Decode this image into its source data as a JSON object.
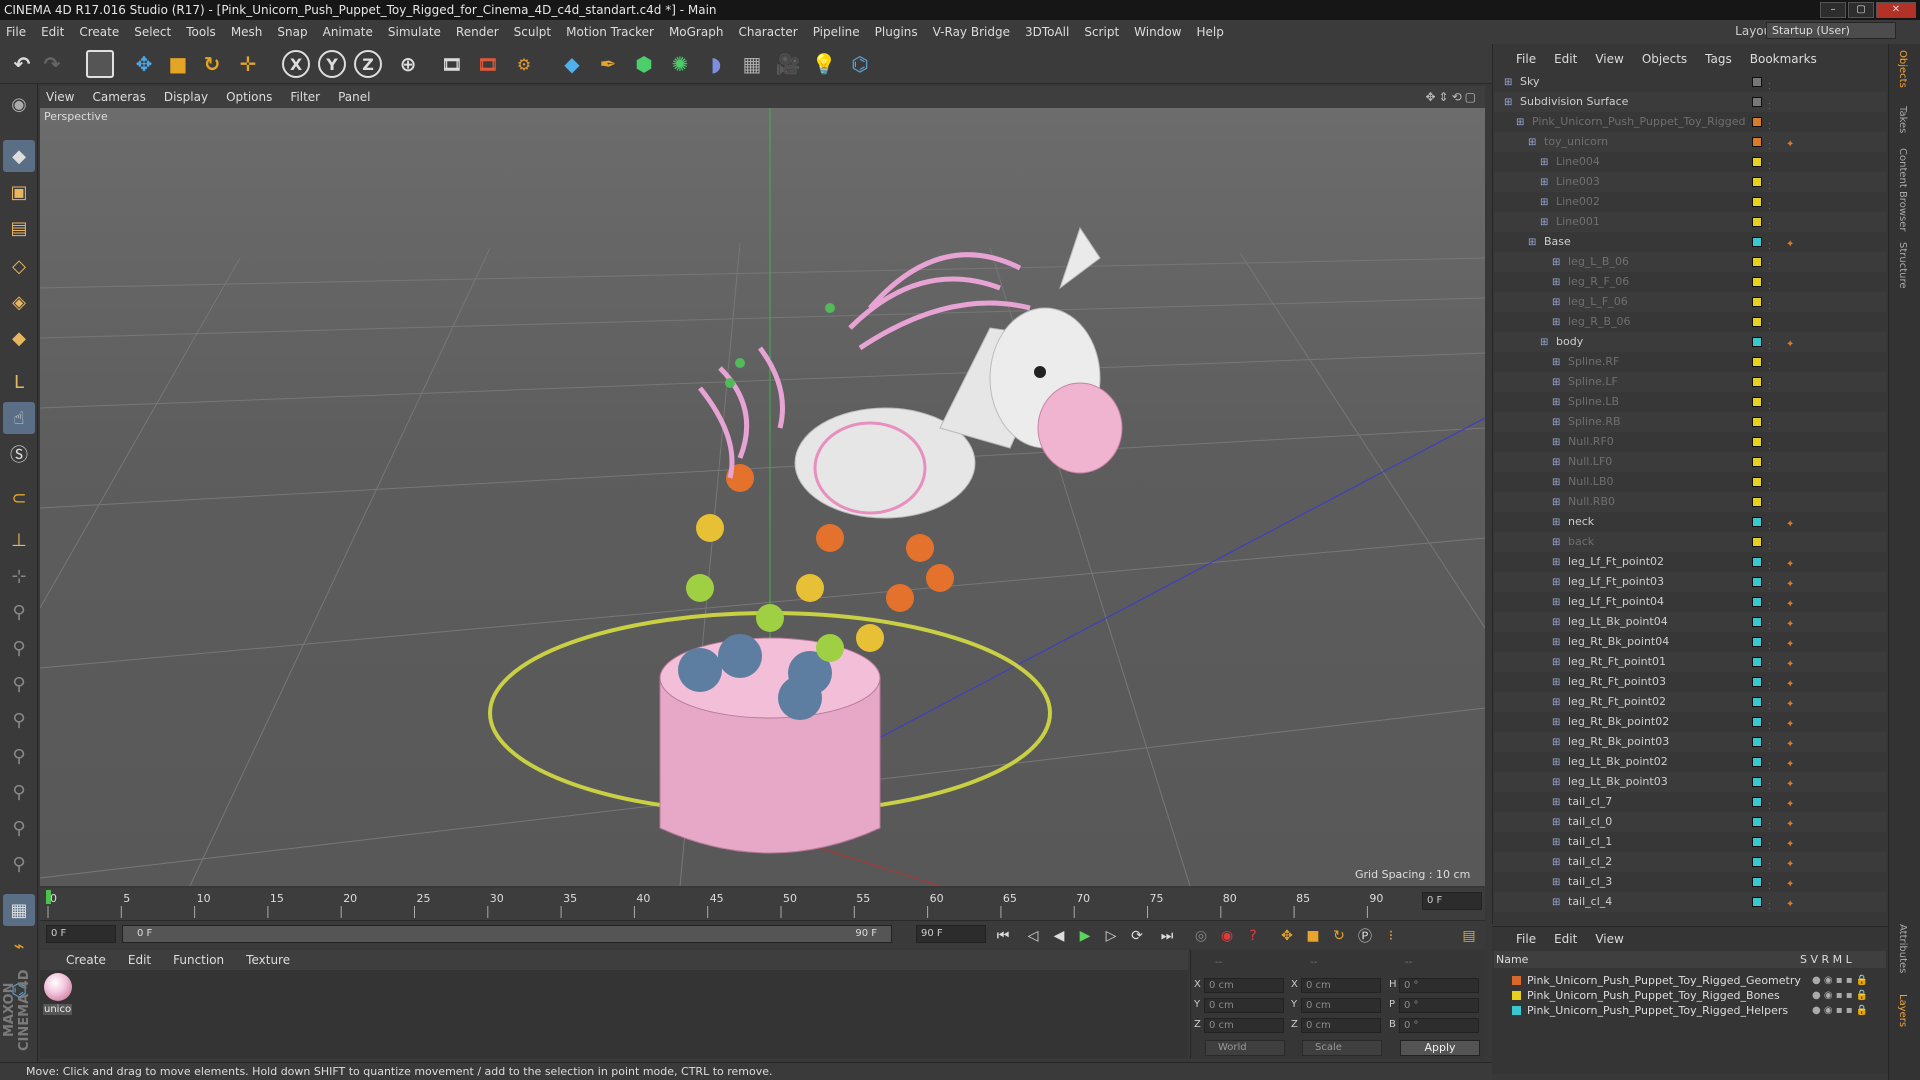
{
  "window": {
    "title": "CINEMA 4D R17.016 Studio (R17) - [Pink_Unicorn_Push_Puppet_Toy_Rigged_for_Cinema_4D_c4d_standart.c4d *] - Main",
    "controls": [
      "–",
      "▢",
      "✕"
    ]
  },
  "menubar": {
    "items": [
      "File",
      "Edit",
      "Create",
      "Select",
      "Tools",
      "Mesh",
      "Snap",
      "Animate",
      "Simulate",
      "Render",
      "Sculpt",
      "Motion Tracker",
      "MoGraph",
      "Character",
      "Pipeline",
      "Plugins",
      "V-Ray Bridge",
      "3DToAll",
      "Script",
      "Window",
      "Help"
    ],
    "layout_label": "Layout:",
    "layout_value": "Startup (User)"
  },
  "toolbar": {
    "icons": [
      "undo-icon",
      "redo-icon",
      "live-selection-icon",
      "move-icon",
      "scale-icon",
      "rotate-icon",
      "last-tool-icon",
      "x-axis-icon",
      "y-axis-icon",
      "z-axis-icon",
      "world-coords-icon",
      "render-view-icon",
      "render-picture-viewer-icon",
      "edit-render-settings-icon",
      "cube-icon",
      "pen-icon",
      "subdivision-icon",
      "array-icon",
      "deformer-icon",
      "floor-icon",
      "camera-icon",
      "light-icon",
      "python-icon"
    ],
    "axis_labels": [
      "X",
      "Y",
      "Z"
    ]
  },
  "left_toolbar": {
    "icons": [
      "make-editable-icon",
      "model-mode-icon",
      "texture-mode-icon",
      "workplane-icon",
      "points-mode-icon",
      "edges-mode-icon",
      "polygons-mode-icon",
      "axis-mode-icon",
      "tweak-icon",
      "solo-icon",
      "snap-icon",
      "locked-workplane-icon",
      "planar-workplane-icon",
      "sculpt-grab-icon",
      "sculpt-smooth-icon",
      "sculpt-pull-icon",
      "sculpt-flatten-icon",
      "sculpt-inflate-icon",
      "sculpt-pinch-icon",
      "sculpt-knife-icon",
      "sculpt-erase-icon",
      "grid-icon",
      "magnet-icon",
      "python-icon"
    ]
  },
  "viewport": {
    "menu": [
      "View",
      "Cameras",
      "Display",
      "Options",
      "Filter",
      "Panel"
    ],
    "label": "Perspective",
    "grid_spacing": "Grid Spacing : 10 cm",
    "axis_x": "x",
    "axis_y": "y",
    "axis_z": "z"
  },
  "timeline": {
    "ticks": [
      "0",
      "5",
      "10",
      "15",
      "20",
      "25",
      "30",
      "35",
      "40",
      "45",
      "50",
      "55",
      "60",
      "65",
      "70",
      "75",
      "80",
      "85",
      "90"
    ],
    "current_frame": "0 F",
    "start_field": "0 F",
    "range_start": "0 F",
    "range_end": "90 F",
    "end_field": "90 F"
  },
  "materials": {
    "menu": [
      "Create",
      "Edit",
      "Function",
      "Texture"
    ],
    "items": [
      {
        "name": "unico"
      }
    ]
  },
  "coordinates": {
    "header": [
      "--",
      "--",
      "--"
    ],
    "rows": [
      {
        "axis": "X",
        "pos": "0 cm",
        "size_axis": "X",
        "size": "0 cm",
        "rot_axis": "H",
        "rot": "0 °"
      },
      {
        "axis": "Y",
        "pos": "0 cm",
        "size_axis": "Y",
        "size": "0 cm",
        "rot_axis": "P",
        "rot": "0 °"
      },
      {
        "axis": "Z",
        "pos": "0 cm",
        "size_axis": "Z",
        "size": "0 cm",
        "rot_axis": "B",
        "rot": "0 °"
      }
    ],
    "mode": "World",
    "transform": "Scale",
    "apply": "Apply"
  },
  "status": "Move: Click and drag to move elements. Hold down SHIFT to quantize movement / add to the selection in point mode, CTRL to remove.",
  "object_manager": {
    "menu": [
      "File",
      "Edit",
      "View",
      "Objects",
      "Tags",
      "Bookmarks"
    ],
    "rows": [
      {
        "name": "Sky",
        "indent": 0,
        "color": "none",
        "dim": false,
        "tags": false
      },
      {
        "name": "Subdivision Surface",
        "indent": 0,
        "color": "none",
        "dim": false,
        "tags": false
      },
      {
        "name": "Pink_Unicorn_Push_Puppet_Toy_Rigged",
        "indent": 1,
        "color": "#d87c2c",
        "dim": true,
        "tags": false
      },
      {
        "name": "toy_unicorn",
        "indent": 2,
        "color": "#d87c2c",
        "dim": true,
        "tags": true
      },
      {
        "name": "Line004",
        "indent": 3,
        "color": "#e6d020",
        "dim": true,
        "tags": false
      },
      {
        "name": "Line003",
        "indent": 3,
        "color": "#e6d020",
        "dim": true,
        "tags": false
      },
      {
        "name": "Line002",
        "indent": 3,
        "color": "#e6d020",
        "dim": true,
        "tags": false
      },
      {
        "name": "Line001",
        "indent": 3,
        "color": "#e6d020",
        "dim": true,
        "tags": false
      },
      {
        "name": "Base",
        "indent": 2,
        "color": "#39c7d0",
        "dim": false,
        "tags": true
      },
      {
        "name": "leg_L_B_06",
        "indent": 4,
        "color": "#e6d020",
        "dim": true,
        "tags": false
      },
      {
        "name": "leg_R_F_06",
        "indent": 4,
        "color": "#e6d020",
        "dim": true,
        "tags": false
      },
      {
        "name": "leg_L_F_06",
        "indent": 4,
        "color": "#e6d020",
        "dim": true,
        "tags": false
      },
      {
        "name": "leg_R_B_06",
        "indent": 4,
        "color": "#e6d020",
        "dim": true,
        "tags": false
      },
      {
        "name": "body",
        "indent": 3,
        "color": "#39c7d0",
        "dim": false,
        "tags": true
      },
      {
        "name": "Spline.RF",
        "indent": 4,
        "color": "#e6d020",
        "dim": true,
        "tags": false
      },
      {
        "name": "Spline.LF",
        "indent": 4,
        "color": "#e6d020",
        "dim": true,
        "tags": false
      },
      {
        "name": "Spline.LB",
        "indent": 4,
        "color": "#e6d020",
        "dim": true,
        "tags": false
      },
      {
        "name": "Spline.RB",
        "indent": 4,
        "color": "#e6d020",
        "dim": true,
        "tags": false
      },
      {
        "name": "Null.RF0",
        "indent": 4,
        "color": "#e6d020",
        "dim": true,
        "tags": false
      },
      {
        "name": "Null.LF0",
        "indent": 4,
        "color": "#e6d020",
        "dim": true,
        "tags": false
      },
      {
        "name": "Null.LB0",
        "indent": 4,
        "color": "#e6d020",
        "dim": true,
        "tags": false
      },
      {
        "name": "Null.RB0",
        "indent": 4,
        "color": "#e6d020",
        "dim": true,
        "tags": false
      },
      {
        "name": "neck",
        "indent": 4,
        "color": "#39c7d0",
        "dim": false,
        "tags": true
      },
      {
        "name": "back",
        "indent": 4,
        "color": "#e6d020",
        "dim": true,
        "tags": false
      },
      {
        "name": "leg_Lf_Ft_point02",
        "indent": 4,
        "color": "#39c7d0",
        "dim": false,
        "tags": true
      },
      {
        "name": "leg_Lf_Ft_point03",
        "indent": 4,
        "color": "#39c7d0",
        "dim": false,
        "tags": true
      },
      {
        "name": "leg_Lf_Ft_point04",
        "indent": 4,
        "color": "#39c7d0",
        "dim": false,
        "tags": true
      },
      {
        "name": "leg_Lt_Bk_point04",
        "indent": 4,
        "color": "#39c7d0",
        "dim": false,
        "tags": true
      },
      {
        "name": "leg_Rt_Bk_point04",
        "indent": 4,
        "color": "#39c7d0",
        "dim": false,
        "tags": true
      },
      {
        "name": "leg_Rt_Ft_point01",
        "indent": 4,
        "color": "#39c7d0",
        "dim": false,
        "tags": true
      },
      {
        "name": "leg_Rt_Ft_point03",
        "indent": 4,
        "color": "#39c7d0",
        "dim": false,
        "tags": true
      },
      {
        "name": "leg_Rt_Ft_point02",
        "indent": 4,
        "color": "#39c7d0",
        "dim": false,
        "tags": true
      },
      {
        "name": "leg_Rt_Bk_point02",
        "indent": 4,
        "color": "#39c7d0",
        "dim": false,
        "tags": true
      },
      {
        "name": "leg_Rt_Bk_point03",
        "indent": 4,
        "color": "#39c7d0",
        "dim": false,
        "tags": true
      },
      {
        "name": "leg_Lt_Bk_point02",
        "indent": 4,
        "color": "#39c7d0",
        "dim": false,
        "tags": true
      },
      {
        "name": "leg_Lt_Bk_point03",
        "indent": 4,
        "color": "#39c7d0",
        "dim": false,
        "tags": true
      },
      {
        "name": "tail_cl_7",
        "indent": 4,
        "color": "#39c7d0",
        "dim": false,
        "tags": true
      },
      {
        "name": "tail_cl_0",
        "indent": 4,
        "color": "#39c7d0",
        "dim": false,
        "tags": true
      },
      {
        "name": "tail_cl_1",
        "indent": 4,
        "color": "#39c7d0",
        "dim": false,
        "tags": true
      },
      {
        "name": "tail_cl_2",
        "indent": 4,
        "color": "#39c7d0",
        "dim": false,
        "tags": true
      },
      {
        "name": "tail_cl_3",
        "indent": 4,
        "color": "#39c7d0",
        "dim": false,
        "tags": true
      },
      {
        "name": "tail_cl_4",
        "indent": 4,
        "color": "#39c7d0",
        "dim": false,
        "tags": true
      }
    ]
  },
  "layers": {
    "menu": [
      "File",
      "Edit",
      "View"
    ],
    "headers": {
      "name": "Name",
      "cols": "S  V  R  M  L"
    },
    "rows": [
      {
        "name": "Pink_Unicorn_Push_Puppet_Toy_Rigged_Geometry",
        "color": "#d8682c"
      },
      {
        "name": "Pink_Unicorn_Push_Puppet_Toy_Rigged_Bones",
        "color": "#e6d020"
      },
      {
        "name": "Pink_Unicorn_Push_Puppet_Toy_Rigged_Helpers",
        "color": "#39c7d0"
      }
    ]
  },
  "right_tabs": [
    "Objects",
    "Takes",
    "Content Browser",
    "Structure",
    "Attributes",
    "Layers"
  ]
}
